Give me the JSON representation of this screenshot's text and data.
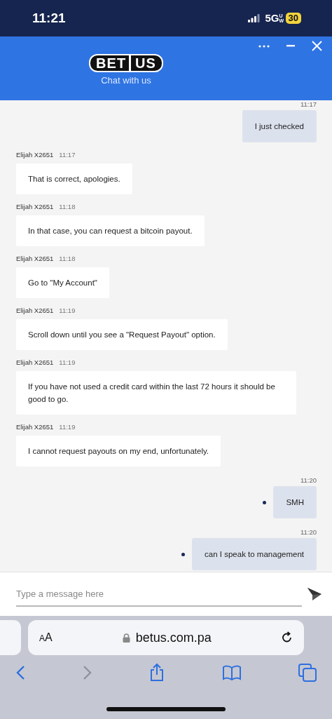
{
  "status_bar": {
    "time": "11:21",
    "network": "5G",
    "network_badge": "UW",
    "battery": "30"
  },
  "header": {
    "logo_left": "BET",
    "logo_right": "US",
    "subtitle": "Chat with us"
  },
  "messages": [
    {
      "kind": "customer",
      "time": "11:17",
      "text": "I just checked",
      "pending": false
    },
    {
      "kind": "agent",
      "sender": "Elijah X2651",
      "time": "11:17",
      "text": "That is correct, apologies."
    },
    {
      "kind": "agent",
      "sender": "Elijah X2651",
      "time": "11:18",
      "text": "In that case, you can request a bitcoin payout."
    },
    {
      "kind": "agent",
      "sender": "Elijah X2651",
      "time": "11:18",
      "text": "Go to \"My Account\""
    },
    {
      "kind": "agent",
      "sender": "Elijah X2651",
      "time": "11:19",
      "text": "Scroll down until you see a \"Request Payout\" option."
    },
    {
      "kind": "agent",
      "sender": "Elijah X2651",
      "time": "11:19",
      "text": "If you have not used a credit card within the last 72 hours it should be good to go."
    },
    {
      "kind": "agent",
      "sender": "Elijah X2651",
      "time": "11:19",
      "text": "I cannot request payouts on my end, unfortunately."
    },
    {
      "kind": "customer",
      "time": "11:20",
      "text": "SMH",
      "pending": true
    },
    {
      "kind": "customer",
      "time": "11:20",
      "text": "can I speak to management",
      "pending": true
    }
  ],
  "composer": {
    "placeholder": "Type a message here"
  },
  "browser": {
    "text_size": "AA",
    "url": "betus.com.pa",
    "forward_disabled": true
  }
}
